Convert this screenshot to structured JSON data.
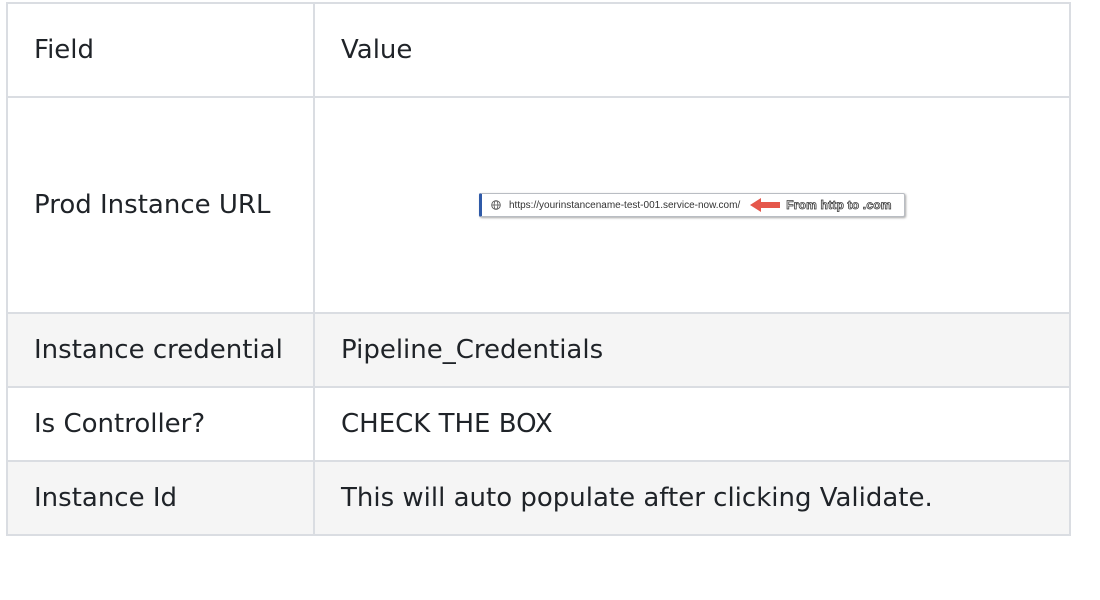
{
  "table": {
    "headers": {
      "field": "Field",
      "value": "Value"
    },
    "rows": [
      {
        "field": "Prod Instance URL",
        "image": {
          "url_text": "https://yourinstancename-test-001.service-now.com/",
          "annotation": "From http to .com",
          "arrow_color": "#e5574b"
        }
      },
      {
        "field": "Instance credential",
        "value": "Pipeline_Credentials"
      },
      {
        "field": "Is Controller?",
        "value": "CHECK THE BOX"
      },
      {
        "field": "Instance Id",
        "value": "This will auto populate after clicking Validate."
      }
    ]
  }
}
